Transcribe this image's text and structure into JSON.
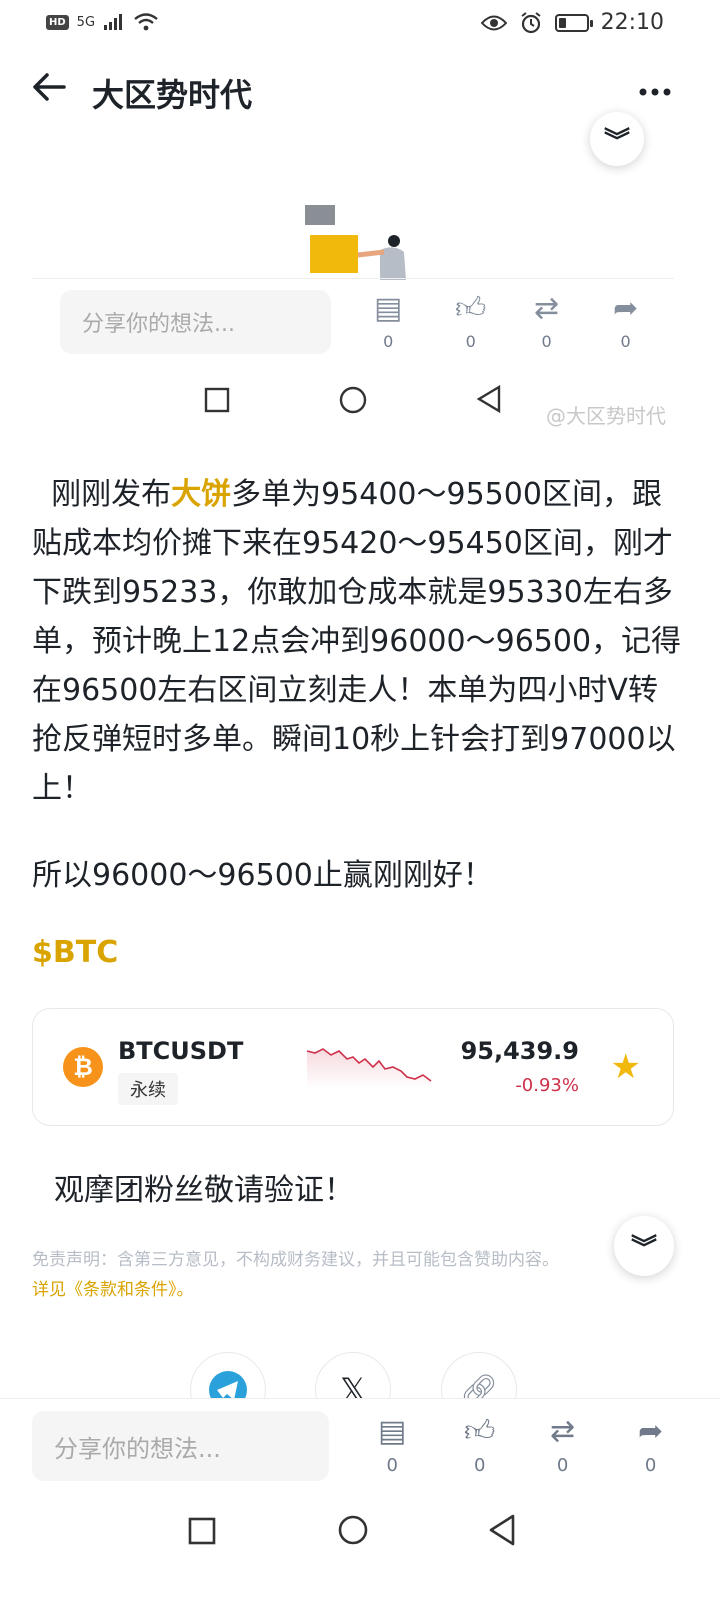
{
  "status": {
    "hd": "HD",
    "network": "5G",
    "time": "22:10",
    "battery_level": 0.3
  },
  "header": {
    "title": "大区势时代",
    "back_icon": "back-arrow-icon",
    "more_icon": "more-icon"
  },
  "embedded": {
    "share_placeholder": "分享你的想法...",
    "counts": [
      "0",
      "0",
      "0",
      "0"
    ],
    "watermark": "@大区势时代"
  },
  "post": {
    "p1_before": "刚刚发布",
    "p1_highlight": "大饼",
    "p1_after": "多单为95400～95500区间，跟贴成本均价摊下来在95420～95450区间，刚才下跌到95233，你敢加仓成本就是95330左右多单，预计晚上12点会冲到96000～96500，记得在96500左右区间立刻走人！本单为四小时V转抢反弹短时多单。瞬间10秒上针会打到97000以上！",
    "p2": "所以96000～96500止赢刚刚好！",
    "tag": "$BTC",
    "verify": "观摩团粉丝敬请验证！"
  },
  "ticker": {
    "symbol": "BTCUSDT",
    "type": "永续",
    "price": "95,439.9",
    "change": "-0.93%",
    "change_color": "#cf304a",
    "coin_glyph": "₿"
  },
  "disclaimer": {
    "text": "免责声明：含第三方意见，不构成财务建议，并且可能包含赞助内容。",
    "link": "详见《条款和条件》。"
  },
  "bottom": {
    "share_placeholder": "分享你的想法...",
    "counts": [
      "0",
      "0",
      "0",
      "0"
    ]
  },
  "colors": {
    "accent": "#d9a400",
    "star": "#f0b90b",
    "negative": "#cf304a"
  }
}
